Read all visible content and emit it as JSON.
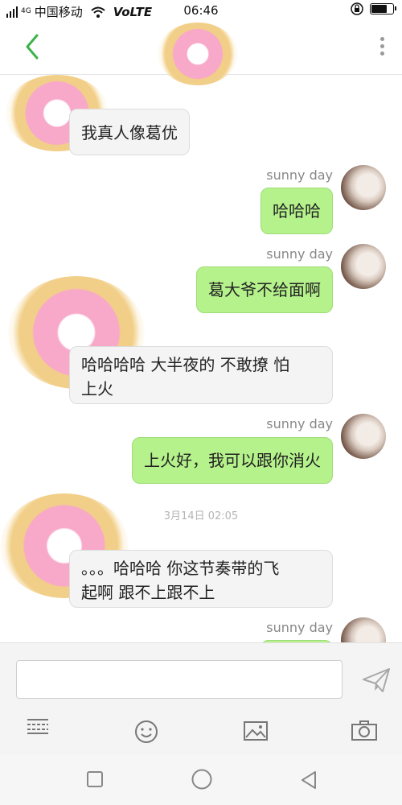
{
  "status_bar": {
    "signal_label": "4G",
    "carrier": "中国移动",
    "volte": "VoLTE",
    "time": "06:46",
    "battery_level": 0.8
  },
  "header": {
    "back_icon": "chevron-left-icon",
    "more_icon": "more-vertical-icon"
  },
  "messages": [
    {
      "direction": "in",
      "text": "我真人像葛优"
    },
    {
      "direction": "out",
      "sender": "sunny day",
      "text": "哈哈哈"
    },
    {
      "direction": "out",
      "sender": "sunny day",
      "text": "葛大爷不给面啊"
    },
    {
      "direction": "in",
      "line1": "哈哈哈哈 大半夜的 不敢撩 怕",
      "line2": "上火"
    },
    {
      "direction": "out",
      "sender": "sunny day",
      "text": "上火好，我可以跟你消火"
    },
    {
      "direction": "in",
      "line1": "。。。哈哈哈 你这节奏带的飞",
      "line2": "起啊 跟不上跟不上"
    },
    {
      "direction": "out",
      "sender": "sunny day",
      "text": ""
    }
  ],
  "timestamp": "3月14日 02:05",
  "input": {
    "placeholder": ""
  },
  "toolbar": {
    "icons": [
      "keyboard-icon",
      "emoji-icon",
      "image-icon",
      "camera-icon"
    ],
    "send_icon": "send-icon"
  },
  "nav": {
    "icons": [
      "square-icon",
      "circle-icon",
      "triangle-back-icon"
    ]
  },
  "colors": {
    "accent": "#3cb34a",
    "outgoing_bubble": "#b5f28c",
    "incoming_bubble": "#f4f4f4"
  }
}
